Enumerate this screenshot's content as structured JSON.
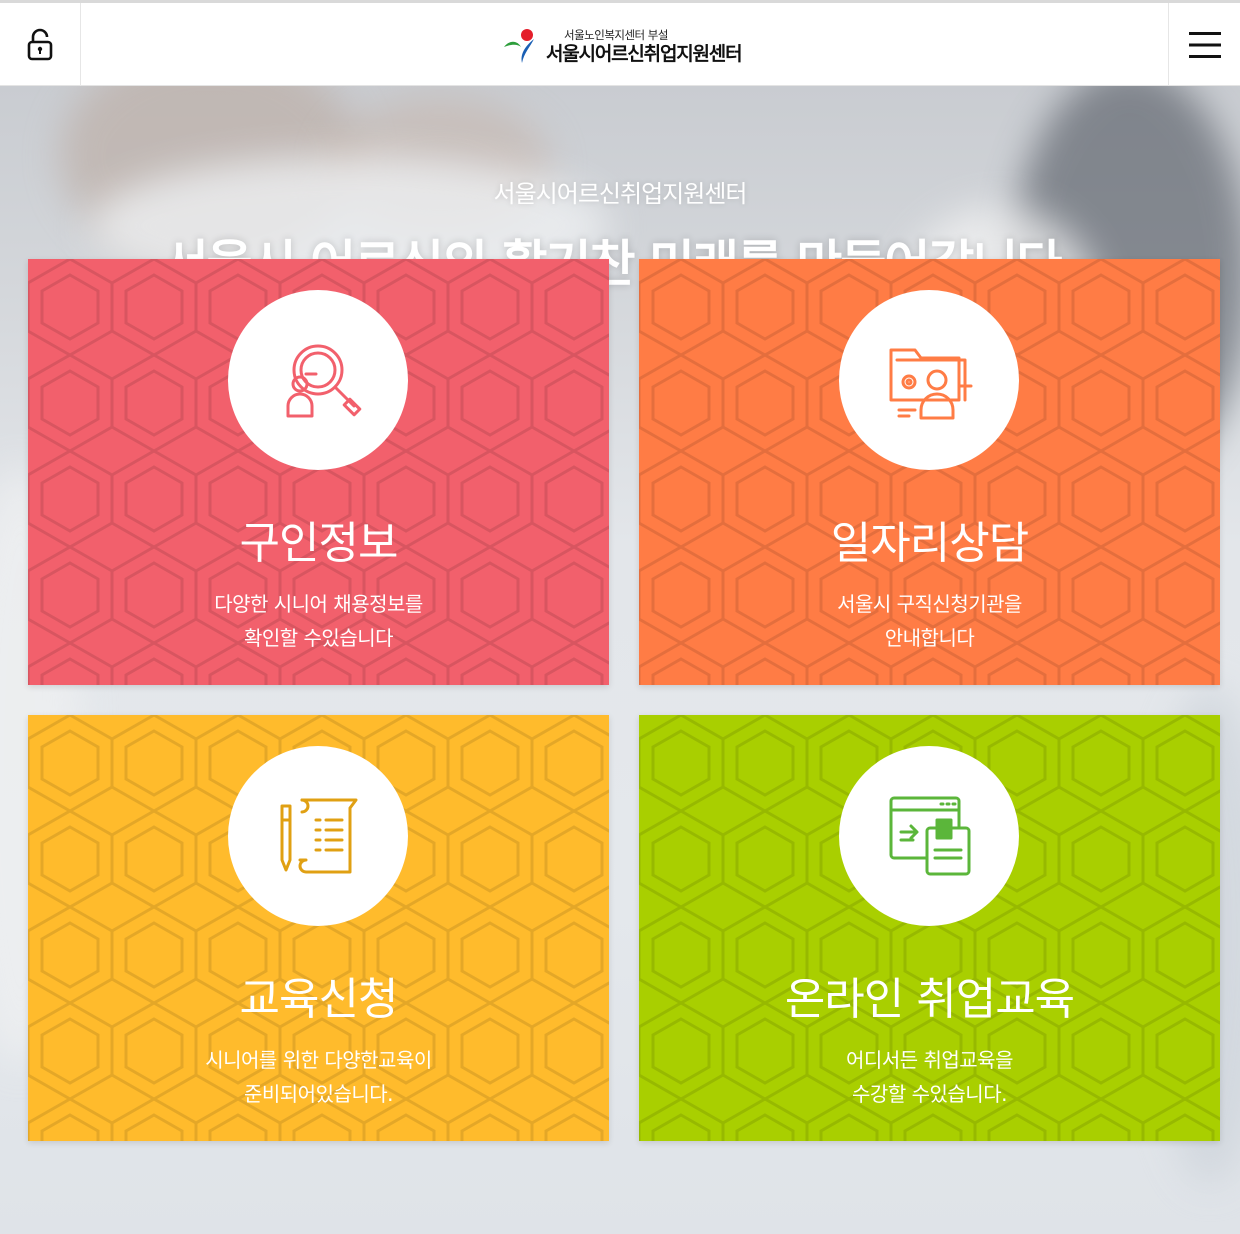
{
  "header": {
    "logo_sub": "서울노인복지센터 부설",
    "logo_main": "서울시어르신취업지원센터",
    "lock_icon": "lock-open-icon",
    "menu_icon": "hamburger-menu-icon"
  },
  "hero": {
    "subtitle": "서울시어르신취업지원센터",
    "title": "서울시 어르신의 활기찬 미래를 만들어갑니다."
  },
  "cards": [
    {
      "title": "구인정보",
      "desc_line1": "다양한 시니어 채용정보를",
      "desc_line2": "확인할 수있습니다",
      "icon": "job-search-icon",
      "color": "#f2606c",
      "icon_color": "#f2606c"
    },
    {
      "title": "일자리상담",
      "desc_line1": "서울시 구직신청기관을",
      "desc_line2": "안내합니다",
      "icon": "consulting-folder-icon",
      "color": "#ff7c45",
      "icon_color": "#ff7c45"
    },
    {
      "title": "교육신청",
      "desc_line1": "시니어를 위한 다양한교육이",
      "desc_line2": "준비되어있습니다.",
      "icon": "pen-document-icon",
      "color": "#ffbb2c",
      "icon_color": "#e0a013"
    },
    {
      "title": "온라인 취업교육",
      "desc_line1": "어디서든 취업교육을",
      "desc_line2": "수강할 수있습니다.",
      "icon": "online-course-icon",
      "color": "#a9cf00",
      "icon_color": "#5bb63a"
    }
  ]
}
